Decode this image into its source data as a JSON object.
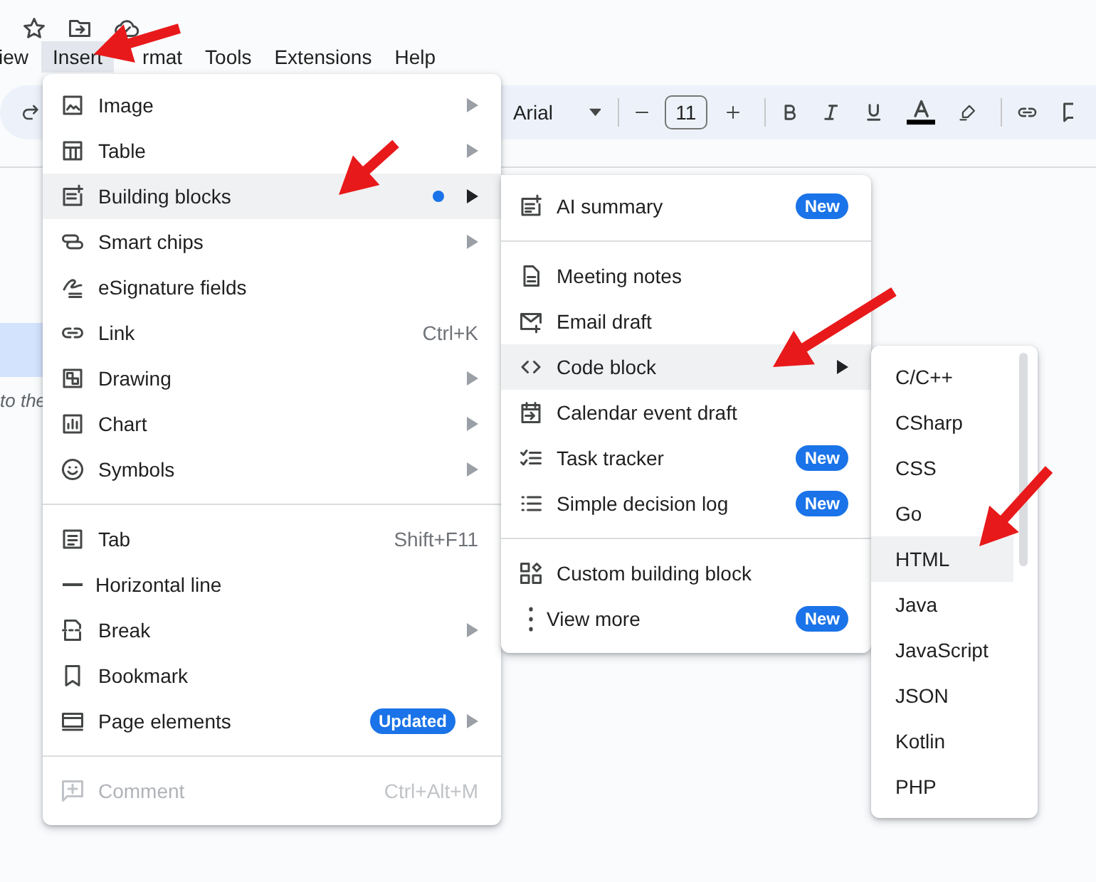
{
  "menu_bar": [
    {
      "label": "iew",
      "selected": false
    },
    {
      "label": "Insert",
      "selected": true
    },
    {
      "label": "rmat",
      "selected": false
    },
    {
      "label": "Tools",
      "selected": false
    },
    {
      "label": "Extensions",
      "selected": false
    },
    {
      "label": "Help",
      "selected": false
    }
  ],
  "toolbar": {
    "font": "Arial",
    "font_size": "11"
  },
  "document": {
    "text": "to the"
  },
  "insert_menu": [
    {
      "kind": "item",
      "label": "Image",
      "submenu": true,
      "highlighted": false,
      "disabled": false,
      "dot": false
    },
    {
      "kind": "item",
      "label": "Table",
      "submenu": true,
      "highlighted": false,
      "disabled": false,
      "dot": false
    },
    {
      "kind": "item",
      "label": "Building blocks",
      "submenu": true,
      "highlighted": true,
      "disabled": false,
      "dot": true
    },
    {
      "kind": "item",
      "label": "Smart chips",
      "submenu": true,
      "highlighted": false,
      "disabled": false,
      "dot": false
    },
    {
      "kind": "item",
      "label": "eSignature fields",
      "submenu": false,
      "highlighted": false,
      "disabled": false,
      "dot": false
    },
    {
      "kind": "item",
      "label": "Link",
      "shortcut": "Ctrl+K",
      "submenu": false,
      "highlighted": false,
      "disabled": false,
      "dot": false
    },
    {
      "kind": "item",
      "label": "Drawing",
      "submenu": true,
      "highlighted": false,
      "disabled": false,
      "dot": false
    },
    {
      "kind": "item",
      "label": "Chart",
      "submenu": true,
      "highlighted": false,
      "disabled": false,
      "dot": false
    },
    {
      "kind": "item",
      "label": "Symbols",
      "submenu": true,
      "highlighted": false,
      "disabled": false,
      "dot": false
    },
    {
      "kind": "divider"
    },
    {
      "kind": "item",
      "label": "Tab",
      "shortcut": "Shift+F11",
      "submenu": false,
      "highlighted": false,
      "disabled": false,
      "dot": false
    },
    {
      "kind": "item",
      "label": "Horizontal line",
      "submenu": false,
      "highlighted": false,
      "disabled": false,
      "dot": false
    },
    {
      "kind": "item",
      "label": "Break",
      "submenu": true,
      "highlighted": false,
      "disabled": false,
      "dot": false
    },
    {
      "kind": "item",
      "label": "Bookmark",
      "submenu": false,
      "highlighted": false,
      "disabled": false,
      "dot": false
    },
    {
      "kind": "item",
      "label": "Page elements",
      "badge": "Updated",
      "submenu": true,
      "highlighted": false,
      "disabled": false,
      "dot": false
    },
    {
      "kind": "divider"
    },
    {
      "kind": "item",
      "label": "Comment",
      "shortcut": "Ctrl+Alt+M",
      "submenu": false,
      "highlighted": false,
      "disabled": true,
      "dot": false
    }
  ],
  "building_blocks_menu": [
    {
      "kind": "item",
      "label": "AI summary",
      "badge": "New",
      "submenu": false,
      "highlighted": false
    },
    {
      "kind": "divider"
    },
    {
      "kind": "item",
      "label": "Meeting notes",
      "submenu": false,
      "highlighted": false
    },
    {
      "kind": "item",
      "label": "Email draft",
      "submenu": false,
      "highlighted": false
    },
    {
      "kind": "item",
      "label": "Code block",
      "submenu": true,
      "highlighted": true
    },
    {
      "kind": "item",
      "label": "Calendar event draft",
      "submenu": false,
      "highlighted": false
    },
    {
      "kind": "item",
      "label": "Task tracker",
      "badge": "New",
      "submenu": false,
      "highlighted": false
    },
    {
      "kind": "item",
      "label": "Simple decision log",
      "badge": "New",
      "submenu": false,
      "highlighted": false
    },
    {
      "kind": "divider"
    },
    {
      "kind": "item",
      "label": "Custom building block",
      "submenu": false,
      "highlighted": false
    },
    {
      "kind": "item",
      "label": "View more",
      "badge": "New",
      "submenu": false,
      "highlighted": false
    }
  ],
  "code_block_menu": [
    {
      "label": "C/C++",
      "highlighted": false
    },
    {
      "label": "CSharp",
      "highlighted": false
    },
    {
      "label": "CSS",
      "highlighted": false
    },
    {
      "label": "Go",
      "highlighted": false
    },
    {
      "label": "HTML",
      "highlighted": true
    },
    {
      "label": "Java",
      "highlighted": false
    },
    {
      "label": "JavaScript",
      "highlighted": false
    },
    {
      "label": "JSON",
      "highlighted": false
    },
    {
      "label": "Kotlin",
      "highlighted": false
    },
    {
      "label": "PHP",
      "highlighted": false
    }
  ]
}
